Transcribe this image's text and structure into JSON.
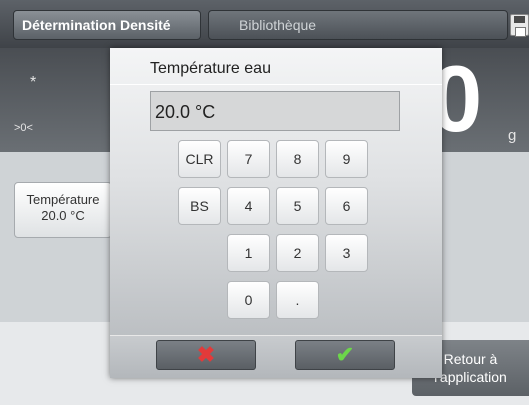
{
  "tabs": {
    "active": "Détermination Densité",
    "library": "Bibliothèque"
  },
  "reading": {
    "stable_indicator": "*",
    "zero_indicator": ">0<",
    "digit": "0",
    "unit": "g"
  },
  "temperature_button": {
    "label": "Température",
    "value": "20.0 °C"
  },
  "return_button": {
    "line1": "Retour à",
    "line2": "l'application"
  },
  "dialog": {
    "title": "Température eau",
    "input_value": "20.0 °C",
    "keys": [
      "CLR",
      "7",
      "8",
      "9",
      "BS",
      "4",
      "5",
      "6",
      "1",
      "2",
      "3",
      "0",
      "."
    ],
    "cancel_icon": "x-icon",
    "confirm_icon": "check-icon"
  },
  "colors": {
    "cancel_mark": "#e33a3a",
    "confirm_mark": "#6cd64a"
  }
}
